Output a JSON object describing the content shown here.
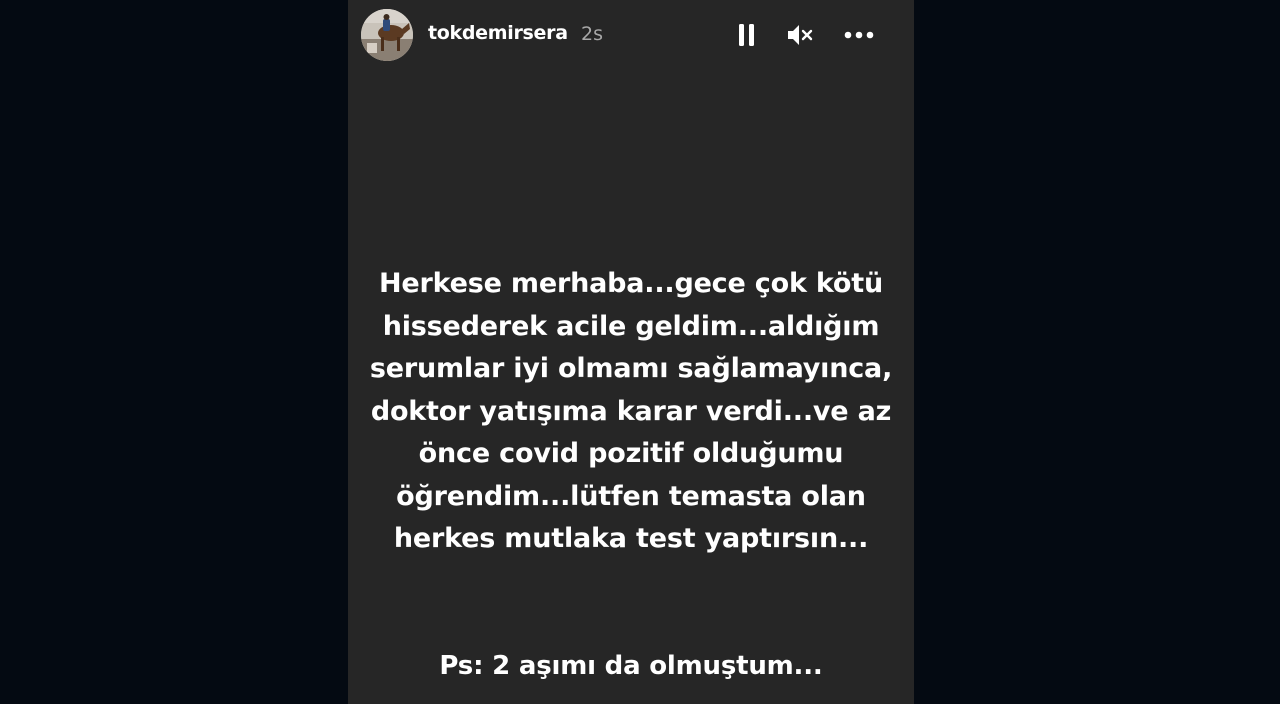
{
  "colors": {
    "page_background": "#050b12",
    "story_background": "#262626",
    "text": "#ffffff",
    "timestamp": "#a8a8a8"
  },
  "header": {
    "username": "tokdemirsera",
    "timestamp": "2s",
    "controls": [
      {
        "name": "pause",
        "icon": "pause-icon"
      },
      {
        "name": "mute",
        "icon": "speaker-muted-icon"
      },
      {
        "name": "more",
        "icon": "more-horizontal-icon"
      }
    ]
  },
  "story": {
    "lines": [
      "Herkese merhaba...gece çok kötü",
      "hissederek acile geldim...aldığım",
      "serumlar iyi olmamı sağlamayınca,",
      "doktor yatışıma karar verdi...ve az",
      "önce covid pozitif olduğumu",
      "öğrendim...lütfen temasta olan",
      "herkes mutlaka test yaptırsın..."
    ],
    "ps": "Ps: 2 aşımı da olmuştum..."
  }
}
